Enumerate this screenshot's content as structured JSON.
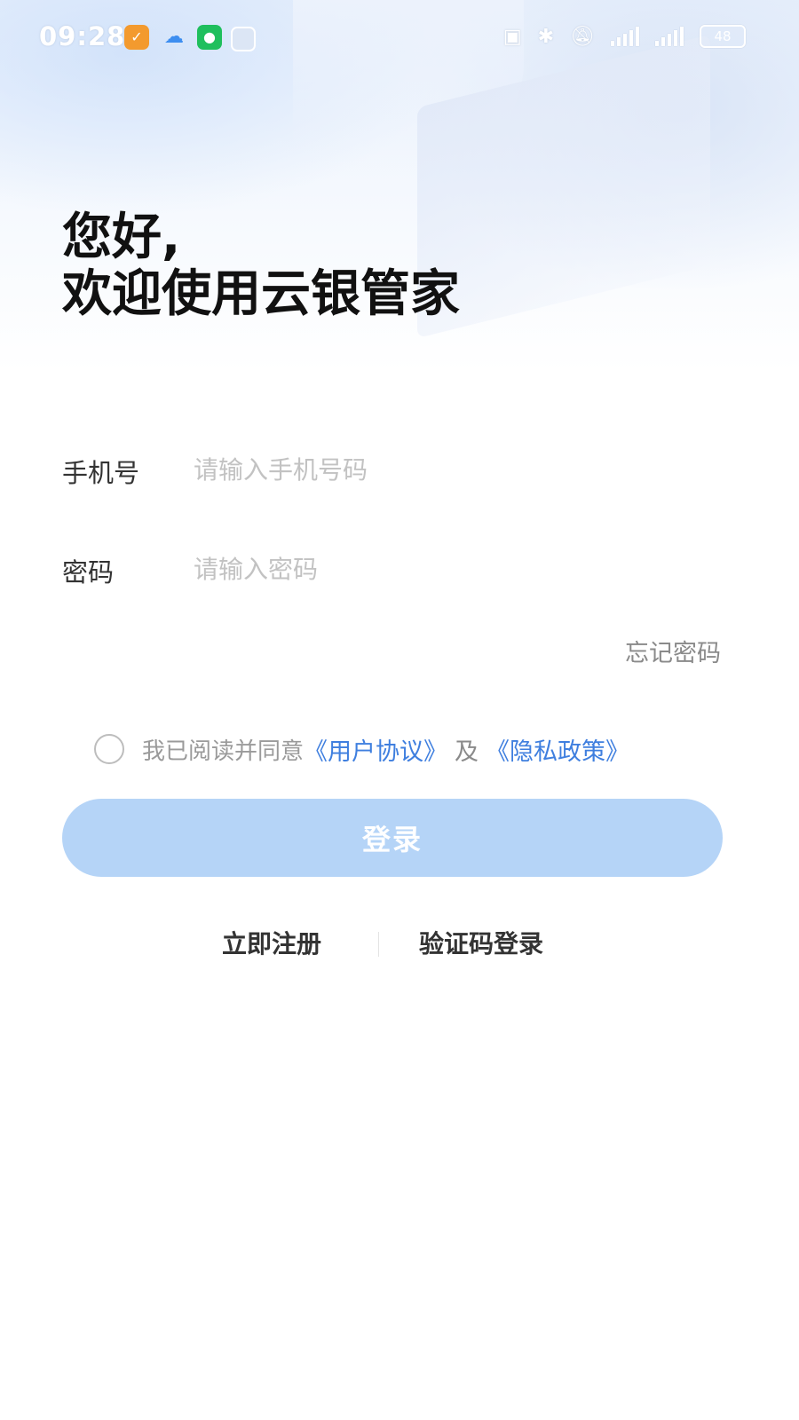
{
  "status_bar": {
    "time": "09:28",
    "app_icons": [
      "orange-app-icon",
      "cloud-app-icon",
      "wechat-icon",
      "app-square-icon"
    ],
    "battery": "48",
    "right_icons": [
      "nfc-icon",
      "bluetooth-icon",
      "mute-icon",
      "signal-icon",
      "signal-icon",
      "battery-icon"
    ]
  },
  "header": {
    "greeting_line1": "您好,",
    "greeting_line2": "欢迎使用云银管家"
  },
  "form": {
    "phone_label": "手机号",
    "phone_placeholder": "请输入手机号码",
    "phone_value": "",
    "password_label": "密码",
    "password_placeholder": "请输入密码",
    "password_value": "",
    "forgot_label": "忘记密码"
  },
  "agreement": {
    "checked": false,
    "prefix": "我已阅读并同意",
    "user_agreement": "《用户协议》",
    "and": "及",
    "privacy_policy": "《隐私政策》"
  },
  "actions": {
    "login_label": "登录",
    "register_label": "立即注册",
    "sms_login_label": "验证码登录"
  },
  "colors": {
    "primary_disabled": "#b5d4f7",
    "link": "#3f7fdf",
    "placeholder": "#c2c2c2"
  }
}
